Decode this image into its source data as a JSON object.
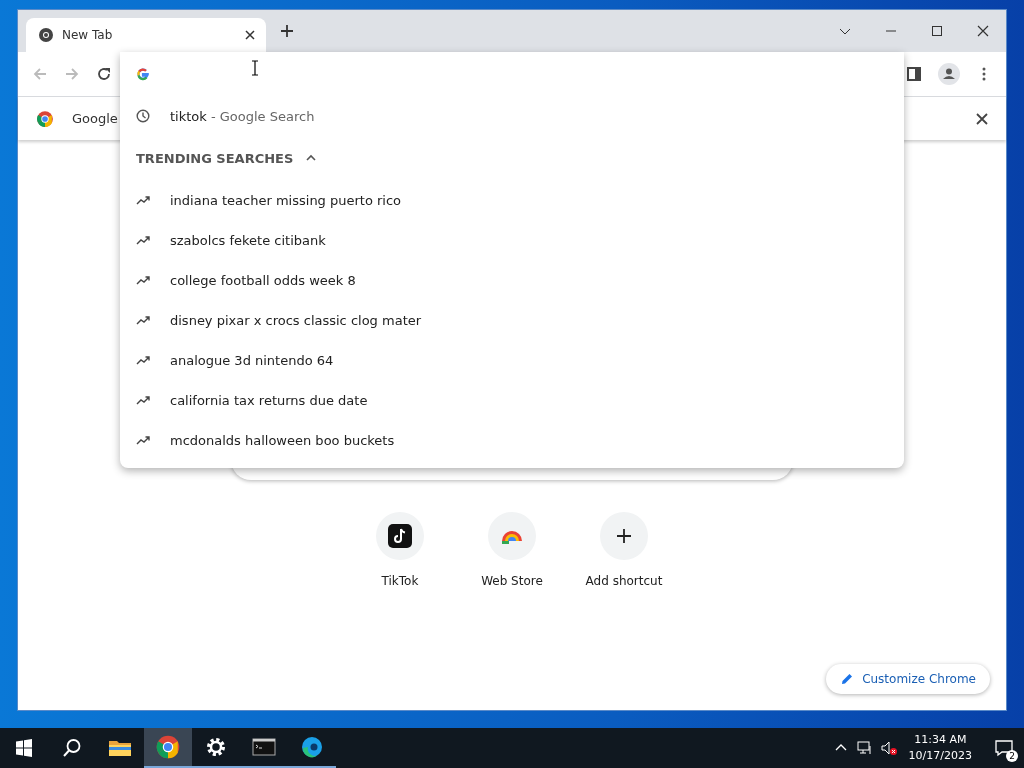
{
  "tabs": [
    {
      "title": "New Tab",
      "selected": true
    }
  ],
  "infobar": {
    "text": "Google"
  },
  "omnibox": {
    "history": [
      {
        "query": "tiktok",
        "suffix": "- Google Search"
      }
    ],
    "trending": {
      "heading": "TRENDING SEARCHES",
      "expanded": true,
      "items": [
        "indiana teacher missing puerto rico",
        "szabolcs fekete citibank",
        "college football odds week 8",
        "disney pixar x crocs classic clog mater",
        "analogue 3d nintendo 64",
        "california tax returns due date",
        "mcdonalds halloween boo buckets"
      ]
    }
  },
  "shortcuts": [
    {
      "label": "TikTok",
      "kind": "tiktok"
    },
    {
      "label": "Web Store",
      "kind": "webstore"
    },
    {
      "label": "Add shortcut",
      "kind": "add"
    }
  ],
  "customize_button": "Customize Chrome",
  "taskbar": {
    "apps": [
      {
        "kind": "explorer",
        "selected": false,
        "running": false
      },
      {
        "kind": "chrome",
        "selected": true,
        "running": true
      },
      {
        "kind": "settings",
        "selected": false,
        "running": true
      },
      {
        "kind": "terminal",
        "selected": false,
        "running": true
      },
      {
        "kind": "edge",
        "selected": false,
        "running": true
      }
    ],
    "time": "11:34 AM",
    "date": "10/17/2023",
    "notifications": "2"
  }
}
